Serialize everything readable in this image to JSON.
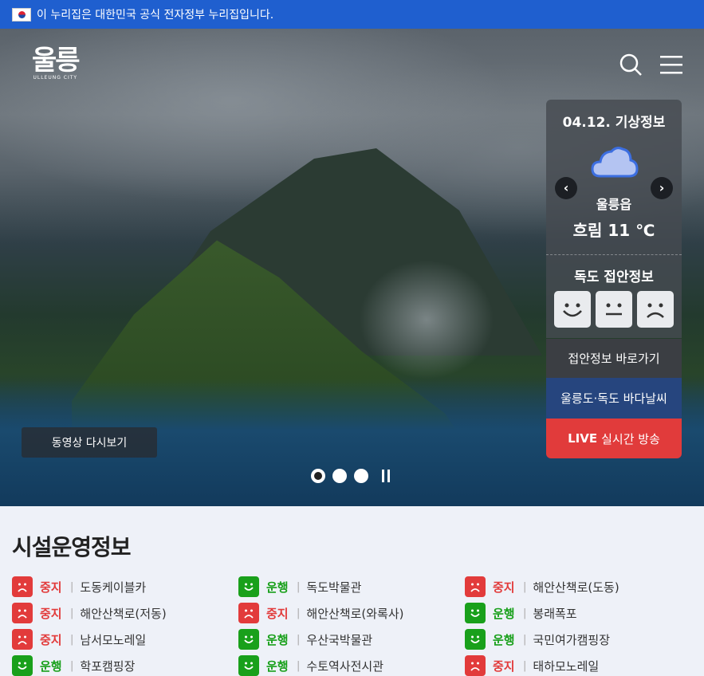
{
  "govbar": {
    "text": "이 누리집은 대한민국 공식 전자정부 누리집입니다."
  },
  "logo": {
    "main": "울릉",
    "sub": "ULLEUNG CITY"
  },
  "weather": {
    "title": "04.12. 기상정보",
    "prev": "‹",
    "next": "›",
    "location": "울릉읍",
    "condition_temp": "흐림 11 ℃",
    "dokdo_title": "독도 접안정보",
    "faces": [
      "good",
      "normal",
      "bad"
    ]
  },
  "buttons": {
    "docking": "접안정보 바로가기",
    "sea_weather": "울릉도·독도 바다날씨",
    "live_prefix": "LIVE",
    "live_label": "실시간 방송"
  },
  "hero": {
    "replay": "동영상 다시보기",
    "slides": 3,
    "active_slide": 1
  },
  "facilities": {
    "title": "시설운영정보",
    "items": [
      {
        "status": "중지",
        "state": "stop",
        "name": "도동케이블카"
      },
      {
        "status": "운행",
        "state": "run",
        "name": "독도박물관"
      },
      {
        "status": "중지",
        "state": "stop",
        "name": "해안산책로(도동)"
      },
      {
        "status": "중지",
        "state": "stop",
        "name": "해안산책로(저동)"
      },
      {
        "status": "중지",
        "state": "stop",
        "name": "해안산책로(와록사)"
      },
      {
        "status": "운행",
        "state": "run",
        "name": "봉래폭포"
      },
      {
        "status": "중지",
        "state": "stop",
        "name": "남서모노레일"
      },
      {
        "status": "운행",
        "state": "run",
        "name": "우산국박물관"
      },
      {
        "status": "운행",
        "state": "run",
        "name": "국민여가캠핑장"
      },
      {
        "status": "운행",
        "state": "run",
        "name": "학포캠핑장"
      },
      {
        "status": "운행",
        "state": "run",
        "name": "수토역사전시관"
      },
      {
        "status": "중지",
        "state": "stop",
        "name": "태하모노레일"
      }
    ]
  },
  "colors": {
    "govbar": "#1f5fcf",
    "stop": "#e23b3b",
    "run": "#19a01b",
    "live": "#e13b3b",
    "sea": "#26457e"
  }
}
